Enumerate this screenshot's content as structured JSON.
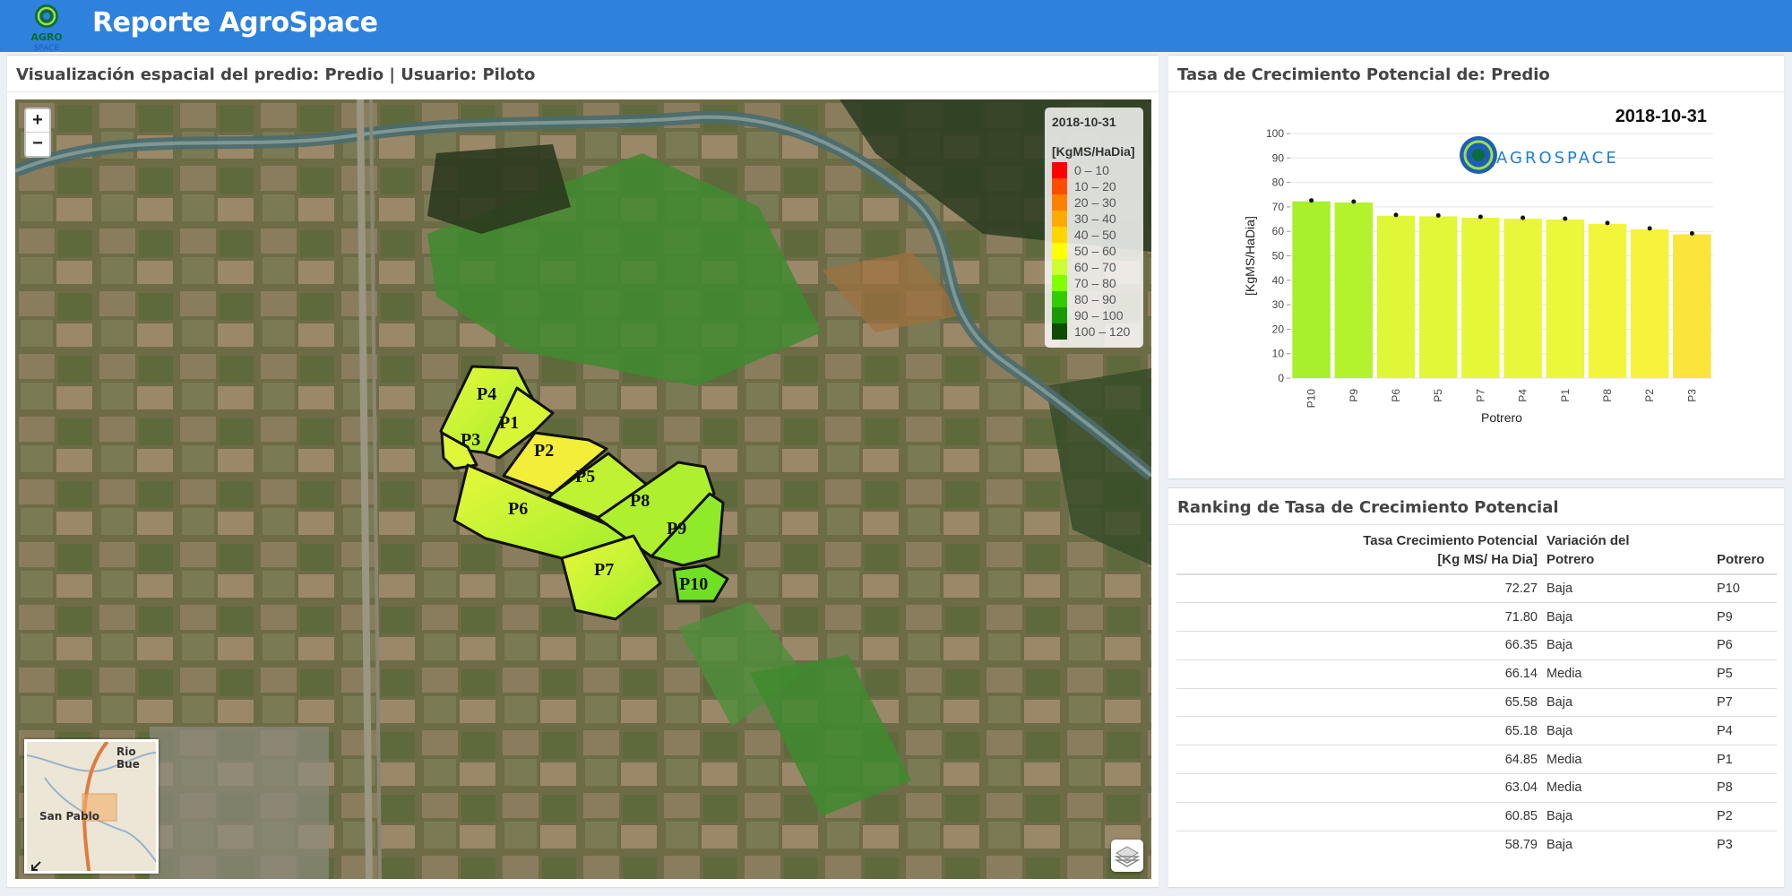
{
  "header": {
    "title": "Reporte AgroSpace"
  },
  "map_panel": {
    "title": "Visualización espacial del predio: Predio | Usuario: Piloto",
    "zoom_in": "+",
    "zoom_out": "−",
    "legend": {
      "date": "2018-10-31",
      "unit": "[KgMS/HaDia]",
      "entries": [
        {
          "label": "0 – 10",
          "color": "#ff0000"
        },
        {
          "label": "10 – 20",
          "color": "#ff4d00"
        },
        {
          "label": "20 – 30",
          "color": "#ff8000"
        },
        {
          "label": "30 – 40",
          "color": "#ffaa00"
        },
        {
          "label": "40 – 50",
          "color": "#ffd500"
        },
        {
          "label": "50 – 60",
          "color": "#ffff00"
        },
        {
          "label": "60 – 70",
          "color": "#ccff33"
        },
        {
          "label": "70 – 80",
          "color": "#80ff00"
        },
        {
          "label": "80 – 90",
          "color": "#33cc00"
        },
        {
          "label": "90 – 100",
          "color": "#1a9900"
        },
        {
          "label": "100 – 120",
          "color": "#0d4d00"
        }
      ]
    },
    "paddocks": [
      "P4",
      "P1",
      "P3",
      "P2",
      "P5",
      "P6",
      "P8",
      "P9",
      "P7",
      "P10"
    ],
    "minimap": {
      "label_top": "Rio Bue",
      "label_city": "San Pablo"
    }
  },
  "chart_panel": {
    "title": "Tasa de Crecimiento Potencial de: Predio"
  },
  "chart_data": {
    "type": "bar",
    "title": "2018-10-31",
    "xlabel": "Potrero",
    "ylabel": "[KgMS/HaDia]",
    "ylim": [
      0,
      100
    ],
    "yticks": [
      0,
      10,
      20,
      30,
      40,
      50,
      60,
      70,
      80,
      90,
      100
    ],
    "categories": [
      "P10",
      "P9",
      "P6",
      "P5",
      "P7",
      "P4",
      "P1",
      "P8",
      "P2",
      "P3"
    ],
    "values": [
      72.27,
      71.8,
      66.35,
      66.14,
      65.58,
      65.18,
      64.85,
      63.04,
      60.85,
      58.79
    ],
    "bar_colors": [
      "#a8f02c",
      "#b3f32e",
      "#e0f738",
      "#e2f738",
      "#e6f738",
      "#e8f739",
      "#ebf739",
      "#f2f53a",
      "#f7f23b",
      "#fbe43c"
    ],
    "grid": true,
    "logo_text": "AGROSPACE"
  },
  "ranking_panel": {
    "title": "Ranking de Tasa de Crecimiento Potencial",
    "columns": [
      "Tasa Crecimiento Potencial\n[Kg MS/ Ha Dia]",
      "Variación del\nPotrero",
      "Potrero"
    ],
    "rows": [
      [
        "72.27",
        "Baja",
        "P10"
      ],
      [
        "71.80",
        "Baja",
        "P9"
      ],
      [
        "66.35",
        "Baja",
        "P6"
      ],
      [
        "66.14",
        "Media",
        "P5"
      ],
      [
        "65.58",
        "Baja",
        "P7"
      ],
      [
        "65.18",
        "Baja",
        "P4"
      ],
      [
        "64.85",
        "Media",
        "P1"
      ],
      [
        "63.04",
        "Media",
        "P8"
      ],
      [
        "60.85",
        "Baja",
        "P2"
      ],
      [
        "58.79",
        "Baja",
        "P3"
      ]
    ]
  }
}
